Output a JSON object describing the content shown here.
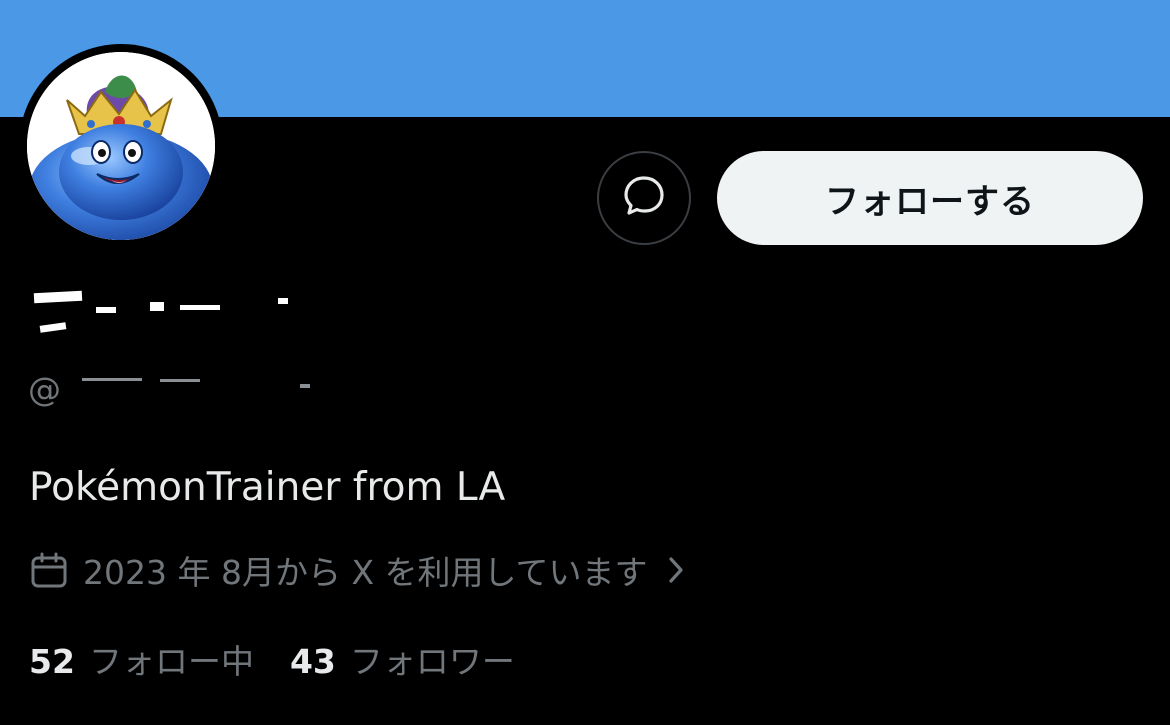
{
  "profile": {
    "follow_label": "フォローする",
    "handle_prefix": "@",
    "bio": "PokémonTrainer from LA",
    "joined": "2023 年 8月から X を利用しています",
    "following_count": "52",
    "following_label": "フォロー中",
    "followers_count": "43",
    "followers_label": "フォロワー"
  },
  "icons": {
    "message": "message-bubble-icon",
    "calendar": "calendar-icon",
    "chevron": "chevron-right-icon"
  },
  "colors": {
    "banner": "#4b99e6",
    "background": "#000000",
    "follow_button": "#eff3f4",
    "secondary_text": "#71767b"
  }
}
